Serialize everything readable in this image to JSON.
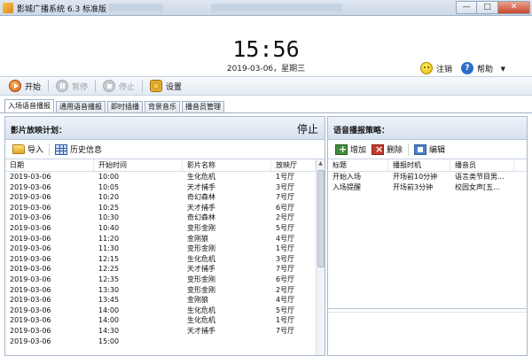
{
  "window": {
    "title": "影城广播系统 6.3 标准版",
    "controls": [
      "—",
      "□",
      "✕"
    ]
  },
  "header": {
    "time": "15:56",
    "date": "2019-03-06，星期三",
    "logout_label": "注销",
    "help_label": "帮助"
  },
  "toolbar": {
    "start_label": "开始",
    "pause_label": "暂停",
    "stop_label": "停止",
    "settings_label": "设置"
  },
  "tabs": [
    {
      "label": "入场语音播报",
      "active": true
    },
    {
      "label": "通用语音播报",
      "active": false
    },
    {
      "label": "即时插播",
      "active": false
    },
    {
      "label": "背景音乐",
      "active": false
    },
    {
      "label": "播音员管理",
      "active": false
    }
  ],
  "left_panel": {
    "title": "影片放映计划：",
    "status": "停止",
    "import_label": "导入",
    "history_label": "历史信息",
    "columns": [
      "日期",
      "开始时间",
      "影片名称",
      "放映厅"
    ],
    "rows": [
      [
        "2019-03-06",
        "10:00",
        "生化危机",
        "1号厅"
      ],
      [
        "2019-03-06",
        "10:05",
        "天才捕手",
        "3号厅"
      ],
      [
        "2019-03-06",
        "10:20",
        "奇幻森林",
        "7号厅"
      ],
      [
        "2019-03-06",
        "10:25",
        "天才捕手",
        "6号厅"
      ],
      [
        "2019-03-06",
        "10:30",
        "奇幻森林",
        "2号厅"
      ],
      [
        "2019-03-06",
        "10:40",
        "变形金刚",
        "5号厅"
      ],
      [
        "2019-03-06",
        "11:20",
        "金刚狼",
        "4号厅"
      ],
      [
        "2019-03-06",
        "11:30",
        "变形金刚",
        "1号厅"
      ],
      [
        "2019-03-06",
        "12:15",
        "生化危机",
        "3号厅"
      ],
      [
        "2019-03-06",
        "12:25",
        "天才捕手",
        "7号厅"
      ],
      [
        "2019-03-06",
        "12:35",
        "变形金刚",
        "6号厅"
      ],
      [
        "2019-03-06",
        "13:30",
        "变形金刚",
        "2号厅"
      ],
      [
        "2019-03-06",
        "13:45",
        "金刚狼",
        "4号厅"
      ],
      [
        "2019-03-06",
        "14:00",
        "生化危机",
        "5号厅"
      ],
      [
        "2019-03-06",
        "14:00",
        "生化危机",
        "1号厅"
      ],
      [
        "2019-03-06",
        "14:30",
        "天才捕手",
        "7号厅"
      ],
      [
        "2019-03-06",
        "15:00",
        "",
        ""
      ]
    ]
  },
  "right_panel": {
    "title": "语音播报策略：",
    "add_label": "增加",
    "delete_label": "删除",
    "edit_label": "编辑",
    "columns": [
      "标题",
      "播报时机",
      "播音员"
    ],
    "rows": [
      [
        "开始入场",
        "开场前10分钟",
        "语言类节目男..."
      ],
      [
        "入场提醒",
        "开场前3分钟",
        "校园女声[五..."
      ]
    ]
  }
}
